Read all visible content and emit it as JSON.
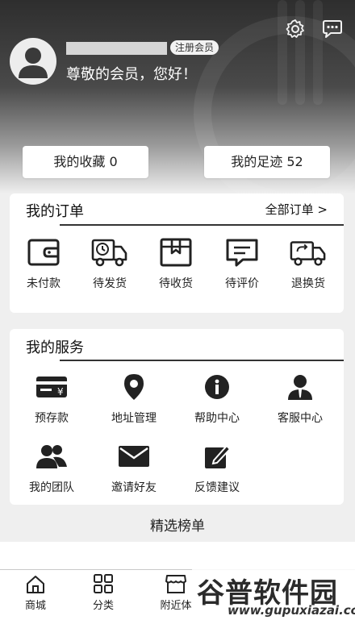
{
  "header": {
    "member_badge": "注册会员",
    "greeting": "尊敬的会员，您好！",
    "icons": [
      "gear-icon",
      "chat-bubble-icon"
    ]
  },
  "stats": {
    "favorites": "我的收藏 0",
    "footprints": "我的足迹 52"
  },
  "orders": {
    "title": "我的订单",
    "all_link": "全部订单 >",
    "items": [
      {
        "label": "未付款",
        "icon": "wallet-icon"
      },
      {
        "label": "待发货",
        "icon": "truck-clock-icon"
      },
      {
        "label": "待收货",
        "icon": "box-icon"
      },
      {
        "label": "待评价",
        "icon": "comment-icon"
      },
      {
        "label": "退换货",
        "icon": "truck-return-icon"
      }
    ]
  },
  "services": {
    "title": "我的服务",
    "items": [
      {
        "label": "预存款",
        "icon": "yen-card-icon"
      },
      {
        "label": "地址管理",
        "icon": "location-pin-icon"
      },
      {
        "label": "帮助中心",
        "icon": "info-icon"
      },
      {
        "label": "客服中心",
        "icon": "agent-icon"
      },
      {
        "label": "我的团队",
        "icon": "team-icon"
      },
      {
        "label": "邀请好友",
        "icon": "envelope-icon"
      },
      {
        "label": "反馈建议",
        "icon": "edit-icon"
      }
    ]
  },
  "featured": {
    "title": "精选榜单"
  },
  "tabbar": {
    "items": [
      {
        "label": "商城",
        "icon": "home-icon"
      },
      {
        "label": "分类",
        "icon": "grid-icon"
      },
      {
        "label": "附近体",
        "icon": "store-icon"
      }
    ]
  },
  "watermark": {
    "logo": "谷普软件园",
    "url": "www.gupuxiazai.com"
  }
}
